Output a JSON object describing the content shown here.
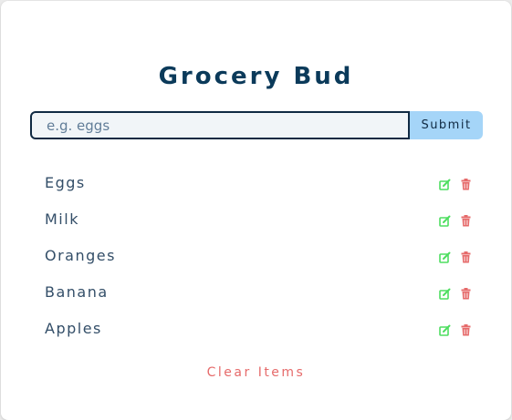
{
  "header": {
    "title": "Grocery Bud"
  },
  "form": {
    "placeholder": "e.g. eggs",
    "value": "",
    "submit_label": "Submit"
  },
  "items": [
    {
      "name": "Eggs",
      "edit_icon": "edit-icon",
      "delete_icon": "trash-icon"
    },
    {
      "name": "Milk",
      "edit_icon": "edit-icon",
      "delete_icon": "trash-icon"
    },
    {
      "name": "Oranges",
      "edit_icon": "edit-icon",
      "delete_icon": "trash-icon"
    },
    {
      "name": "Banana",
      "edit_icon": "edit-icon",
      "delete_icon": "trash-icon"
    },
    {
      "name": "Apples",
      "edit_icon": "edit-icon",
      "delete_icon": "trash-icon"
    }
  ],
  "footer": {
    "clear_label": "Clear Items"
  },
  "colors": {
    "title": "#0b3a5a",
    "submit_bg": "#a5d5f8",
    "edit_icon": "#4ede60",
    "delete_icon": "#e66b6b",
    "clear_text": "#e66b6b"
  }
}
